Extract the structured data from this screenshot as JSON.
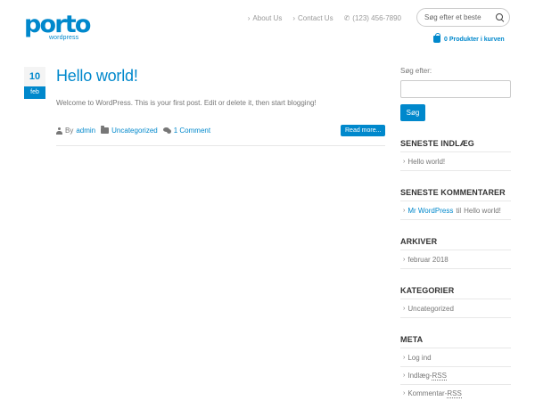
{
  "logo": {
    "main": "porto",
    "sub": "wordpress"
  },
  "topnav": {
    "about": "About Us",
    "contact": "Contact Us",
    "phone": "(123) 456-7890"
  },
  "header_search": {
    "placeholder": "Søg efter et beste"
  },
  "cart": {
    "label": "0 Produkter i kurven"
  },
  "post": {
    "date_day": "10",
    "date_month": "feb",
    "title": "Hello world!",
    "excerpt": "Welcome to WordPress. This is your first post. Edit or delete it, then start blogging!",
    "by_label": "By",
    "author": "admin",
    "category": "Uncategorized",
    "comments": "1 Comment",
    "read_more": "Read more..."
  },
  "sidebar": {
    "search_label": "Søg efter:",
    "search_button": "Søg",
    "recent_posts": {
      "title": "SENESTE INDLÆG",
      "items": [
        "Hello world!"
      ]
    },
    "recent_comments": {
      "title": "SENESTE KOMMENTARER",
      "author": "Mr WordPress",
      "connector": "til",
      "post": "Hello world!"
    },
    "archives": {
      "title": "ARKIVER",
      "items": [
        "februar 2018"
      ]
    },
    "categories": {
      "title": "KATEGORIER",
      "items": [
        "Uncategorized"
      ]
    },
    "meta": {
      "title": "META",
      "login": "Log ind",
      "entries_prefix": "Indlæg-",
      "comments_prefix": "Kommentar-",
      "rss": "RSS"
    }
  },
  "colors": {
    "accent": "#0088cc",
    "heading": "#333333",
    "text": "#777777"
  }
}
